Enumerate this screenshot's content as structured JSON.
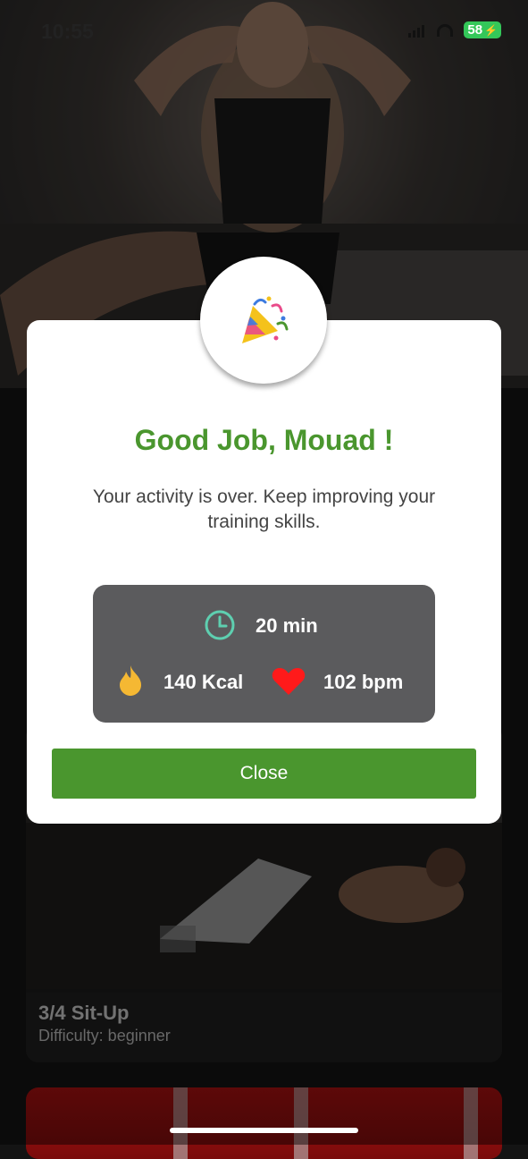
{
  "status_bar": {
    "time": "10:55",
    "battery": "58"
  },
  "workout_card": {
    "title": "3/4 Sit-Up",
    "difficulty": "Difficulty: beginner"
  },
  "modal": {
    "badge_icon": "party-popper-icon",
    "heading": "Good Job, Mouad !",
    "message": "Your activity is over. Keep improving your training skills.",
    "stats": {
      "duration": "20 min",
      "calories": "140 Kcal",
      "heart_rate": "102 bpm"
    },
    "close_label": "Close"
  },
  "colors": {
    "accent": "#4a962e",
    "stats_bg": "#5b5b5d",
    "heart": "#ff1a1a",
    "clock": "#5ecfb0",
    "flame": "#f5b833"
  }
}
